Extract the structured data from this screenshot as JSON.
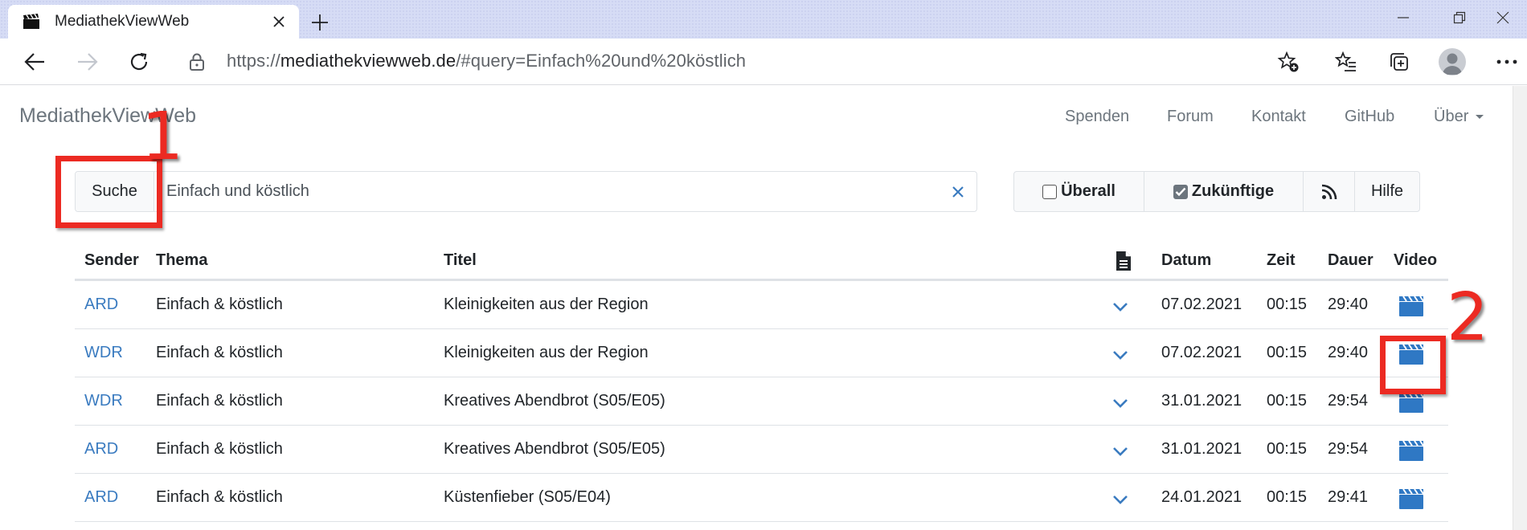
{
  "browser": {
    "tab_title": "MediathekViewWeb",
    "url_scheme": "https://",
    "url_host": "mediathekviewweb.de",
    "url_rest": "/#query=Einfach%20und%20köstlich"
  },
  "site": {
    "brand": "MediathekViewWeb",
    "nav": [
      "Spenden",
      "Forum",
      "Kontakt",
      "GitHub",
      "Über"
    ]
  },
  "search": {
    "button_label": "Suche",
    "value": "Einfach und köstlich",
    "clear_symbol": "×"
  },
  "options": {
    "everywhere_label": "Überall",
    "everywhere_checked": false,
    "future_label": "Zukünftige",
    "future_checked": true,
    "help_label": "Hilfe"
  },
  "table": {
    "headers": {
      "sender": "Sender",
      "thema": "Thema",
      "titel": "Titel",
      "datum": "Datum",
      "zeit": "Zeit",
      "dauer": "Dauer",
      "video": "Video"
    },
    "rows": [
      {
        "sender": "ARD",
        "thema": "Einfach & köstlich",
        "titel": "Kleinigkeiten aus der Region",
        "datum": "07.02.2021",
        "zeit": "00:15",
        "dauer": "29:40"
      },
      {
        "sender": "WDR",
        "thema": "Einfach & köstlich",
        "titel": "Kleinigkeiten aus der Region",
        "datum": "07.02.2021",
        "zeit": "00:15",
        "dauer": "29:40"
      },
      {
        "sender": "WDR",
        "thema": "Einfach & köstlich",
        "titel": "Kreatives Abendbrot (S05/E05)",
        "datum": "31.01.2021",
        "zeit": "00:15",
        "dauer": "29:54"
      },
      {
        "sender": "ARD",
        "thema": "Einfach & köstlich",
        "titel": "Kreatives Abendbrot (S05/E05)",
        "datum": "31.01.2021",
        "zeit": "00:15",
        "dauer": "29:54"
      },
      {
        "sender": "ARD",
        "thema": "Einfach & köstlich",
        "titel": "Küstenfieber (S05/E04)",
        "datum": "24.01.2021",
        "zeit": "00:15",
        "dauer": "29:41"
      }
    ]
  },
  "annotations": {
    "first": "1",
    "second": "2"
  },
  "colors": {
    "link": "#3a7bc0",
    "annotation": "#ec2a22",
    "icon_blue": "#2f78c4"
  }
}
